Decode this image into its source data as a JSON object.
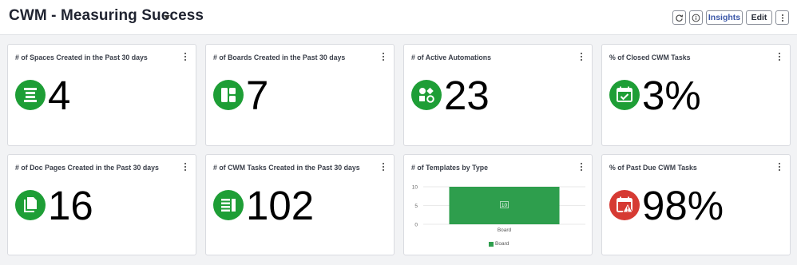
{
  "header": {
    "title": "CWM - Measuring Success",
    "refresh_icon": "refresh-icon",
    "info_icon": "info-icon",
    "insights_label": "Insights",
    "edit_label": "Edit",
    "more_icon": "kebab-icon"
  },
  "colors": {
    "green": "#1e9e36",
    "red": "#d63a33",
    "bar": "#2e9e4d",
    "accent": "#3b57a8"
  },
  "cards": [
    {
      "title": "# of Spaces Created in the Past 30 days",
      "value": "4",
      "icon": "spaces-icon"
    },
    {
      "title": "# of Boards Created in the Past 30 days",
      "value": "7",
      "icon": "boards-icon"
    },
    {
      "title": "# of Active Automations",
      "value": "23",
      "icon": "automations-icon"
    },
    {
      "title": "% of Closed CWM Tasks",
      "value": "3%",
      "icon": "calendar-check-icon"
    },
    {
      "title": "# of Doc Pages Created in the Past 30 days",
      "value": "16",
      "icon": "doc-pages-icon"
    },
    {
      "title": "# of CWM Tasks Created in the Past 30 days",
      "value": "102",
      "icon": "tasks-list-icon"
    },
    {
      "title": "# of Templates by Type"
    },
    {
      "title": "% of Past Due CWM Tasks",
      "value": "98%",
      "icon": "calendar-warning-icon"
    }
  ],
  "chart_data": {
    "type": "bar",
    "title": "# of Templates by Type",
    "categories": [
      "Board"
    ],
    "series": [
      {
        "name": "Board",
        "values": [
          10
        ]
      }
    ],
    "data_labels": [
      "10"
    ],
    "y_ticks": [
      "0",
      "5",
      "10"
    ],
    "ylim": [
      0,
      10
    ],
    "legend": "bottom-center",
    "grid": true
  }
}
